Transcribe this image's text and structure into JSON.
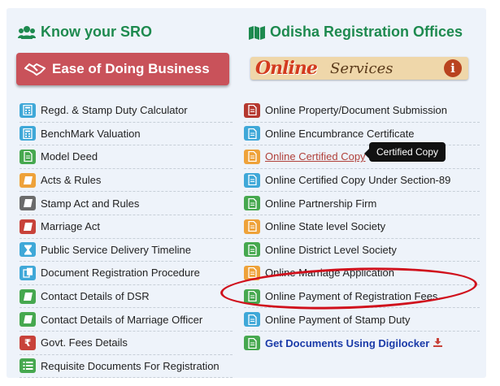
{
  "left": {
    "heading": "Know your SRO",
    "banner": "Ease of Doing Business",
    "items": [
      {
        "label": "Regd. & Stamp Duty Calculator",
        "color": "#3fa8d8",
        "icon": "calculator-icon"
      },
      {
        "label": "BenchMark Valuation",
        "color": "#3fa8d8",
        "icon": "calculator-icon"
      },
      {
        "label": "Model Deed",
        "color": "#46a84f",
        "icon": "document-icon"
      },
      {
        "label": "Acts & Rules",
        "color": "#eea23a",
        "icon": "book-icon"
      },
      {
        "label": "Stamp Act and Rules",
        "color": "#6b6b6b",
        "icon": "book-icon"
      },
      {
        "label": " Marriage Act",
        "color": "#c8423a",
        "icon": "book-icon"
      },
      {
        "label": "Public Service Delivery Timeline",
        "color": "#3fa8d8",
        "icon": "hourglass-icon"
      },
      {
        "label": "Document Registration Procedure",
        "color": "#3fa8d8",
        "icon": "copy-icon"
      },
      {
        "label": "Contact Details of DSR",
        "color": "#46a84f",
        "icon": "book-icon"
      },
      {
        "label": "Contact Details of Marriage Officer",
        "color": "#46a84f",
        "icon": "book-icon"
      },
      {
        "label": "Govt. Fees Details",
        "color": "#c8423a",
        "icon": "rupee-icon"
      },
      {
        "label": "Requisite Documents For Registration",
        "color": "#46a84f",
        "icon": "list-icon"
      }
    ]
  },
  "right": {
    "heading": "Odisha Registration Offices",
    "banner_big": "Online",
    "banner_small": "Services",
    "banner_info": "i",
    "items": [
      {
        "label": "Online Property/Document Submission",
        "color": "#b5382f"
      },
      {
        "label": "Online Encumbrance Certificate",
        "color": "#3fa8d8"
      },
      {
        "label": "Online Certified Copy",
        "color": "#eea23a"
      },
      {
        "label": "Online Certified Copy Under Section-89",
        "color": "#3fa8d8"
      },
      {
        "label": "Online Partnership Firm",
        "color": "#46a84f"
      },
      {
        "label": "Online State level Society",
        "color": "#eea23a"
      },
      {
        "label": "Online District Level Society",
        "color": "#46a84f"
      },
      {
        "label": "Online Marriage Application",
        "color": "#eea23a"
      },
      {
        "label": "Online Payment of Registration Fees.",
        "color": "#46a84f"
      },
      {
        "label": "Online Payment of Stamp Duty",
        "color": "#3fa8d8"
      },
      {
        "label": "Get Documents Using Digilocker",
        "color": "#46a84f"
      }
    ],
    "tooltip": "Certified Copy"
  }
}
